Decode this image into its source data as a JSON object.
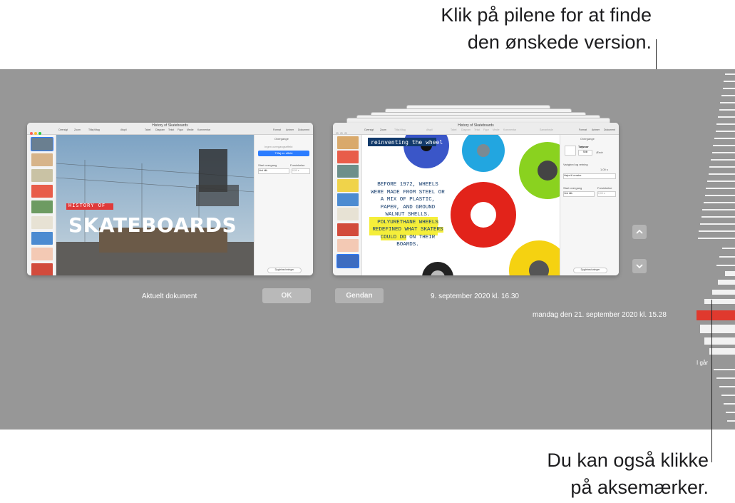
{
  "callouts": {
    "top_line1": "Klik på pilene for at finde",
    "top_line2": "den ønskede version.",
    "bottom_line1": "Du kan også klikke",
    "bottom_line2": "på aksemærker."
  },
  "current_doc": {
    "window_title": "History of Skateboards",
    "label": "Aktuelt dokument",
    "ok_button": "OK",
    "toolbar": [
      "Oversigt",
      "Zoom",
      "Tilføj tiltag",
      "Afspil",
      "Tabel",
      "Diagram",
      "Tekst",
      "Figur",
      "Medie",
      "Kommentar",
      "Format",
      "Animer",
      "Dokument"
    ],
    "slide_text_small": "HISTORY OF",
    "slide_text_big": "SKATEBOARDS",
    "inspector": {
      "heading": "Overgange",
      "none_text": "Ingen overgangseffekt",
      "add_button": "Tilføj en effekt",
      "start_label": "Start overgang",
      "duration_label": "Forsinkelse",
      "start_value": "Ved klik",
      "duration_value": "0,50 s",
      "preview_button": "Dygtrinsvisninger"
    }
  },
  "version_doc": {
    "window_title": "History of Skateboards",
    "restore_button": "Gendan",
    "timestamp": "9. september 2020 kl. 16.30",
    "toolbar": [
      "Oversigt",
      "Zoom",
      "Tilføj tiltag",
      "Afspil",
      "Tabel",
      "Diagram",
      "Tekst",
      "Figur",
      "Medie",
      "Kommentar",
      "Samarbejde",
      "Format",
      "Animer",
      "Dokument"
    ],
    "slide_heading": "reinventing the wheel",
    "slide_body_plain": "BEFORE 1972, WHEELS WERE MADE FROM STEEL OR A MIX OF PLASTIC, PAPER, AND GROUND WALNUT SHELLS.",
    "slide_body_highlight": "POLYURETHANE WHEELS REDEFINED WHAT SKATERS COULD DO",
    "slide_body_end": "ON THEIR BOARDS.",
    "inspector": {
      "heading": "Overgange",
      "effect_name": "Tøjsnor",
      "effect_preview": "Stilit",
      "change_button": "Ændr",
      "duration_label": "Varighed og retning",
      "duration_value": "1,00 s",
      "direction_value": "Højre til venstre",
      "start_label": "Start overgang",
      "delay_label": "Forsinkelse",
      "start_value": "Ved klik",
      "delay_value": "0,00 s",
      "preview_button": "Dygtrinsvisninger"
    }
  },
  "timeline": {
    "selected_label": "mandag den 21. september 2020 kl. 15.28",
    "yesterday_label": "I går",
    "selected_color": "#e0392e"
  },
  "colors": {
    "stage": "#979797",
    "accent_blue": "#2b7cff"
  }
}
